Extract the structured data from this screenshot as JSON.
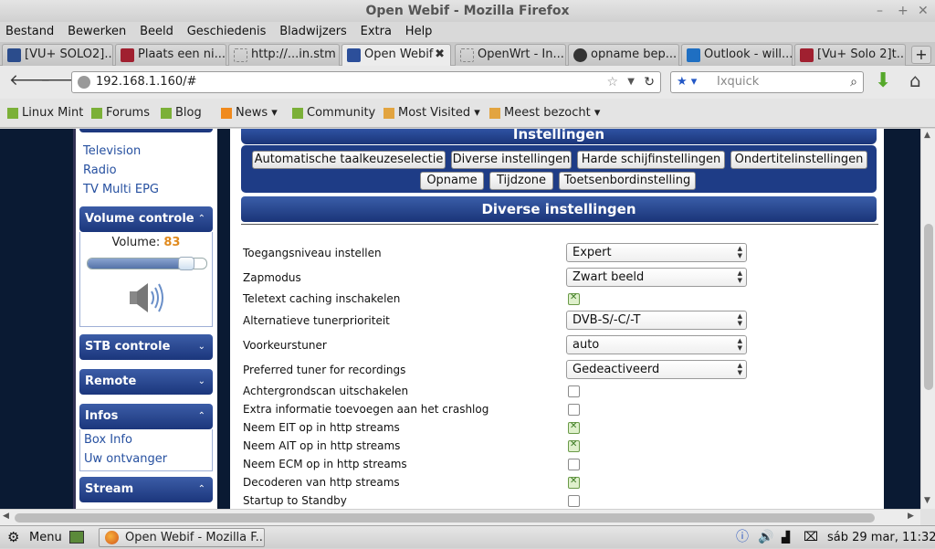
{
  "window": {
    "title": "Open Webif - Mozilla Firefox"
  },
  "menubar": [
    "Bestand",
    "Bewerken",
    "Beeld",
    "Geschiedenis",
    "Bladwijzers",
    "Extra",
    "Help"
  ],
  "tabs": [
    {
      "label": "[VU+ SOLO2]...",
      "icon": "forum-icon",
      "color": "#2b4c8c"
    },
    {
      "label": "Plaats een ni...",
      "icon": "tv-icon",
      "color": "#a02030"
    },
    {
      "label": "http://...in.stm",
      "icon": "blank-page-icon",
      "color": "#ffffff"
    },
    {
      "label": "Open Webif",
      "icon": "openwebif-icon",
      "color": "#2c4f9a",
      "active": true
    },
    {
      "label": "OpenWrt - In...",
      "icon": "blank-page-icon",
      "color": "#ffffff"
    },
    {
      "label": "opname bep...",
      "icon": "globe-icon",
      "color": "#333333"
    },
    {
      "label": "Outlook - will...",
      "icon": "outlook-icon",
      "color": "#1f6fc2"
    },
    {
      "label": "[Vu+ Solo 2]t...",
      "icon": "tv-icon",
      "color": "#a02030"
    }
  ],
  "navbar": {
    "url": "192.168.1.160/#",
    "search_placeholder": "Ixquick"
  },
  "bookmarks": [
    {
      "label": "Linux Mint",
      "icon": "mint-icon"
    },
    {
      "label": "Forums",
      "icon": "mint-icon"
    },
    {
      "label": "Blog",
      "icon": "mint-icon"
    },
    {
      "label": "News ▾",
      "icon": "rss-icon"
    },
    {
      "label": "Community",
      "icon": "mint-icon"
    },
    {
      "label": "Most Visited ▾",
      "icon": "folder-icon"
    },
    {
      "label": "Meest bezocht ▾",
      "icon": "folder-icon"
    }
  ],
  "sidebar": {
    "top_links": [
      "Television",
      "Radio",
      "TV Multi EPG"
    ],
    "volume": {
      "header": "Volume controle",
      "label": "Volume:",
      "value": "83",
      "level": 83
    },
    "stb": "STB controle",
    "remote": "Remote",
    "infos": {
      "header": "Infos",
      "links": [
        "Box Info",
        "Uw ontvanger"
      ]
    },
    "stream": "Stream",
    "chevron_up": "⌃",
    "chevron_down": "⌄"
  },
  "main": {
    "header": "Instellingen",
    "buttons_row1": [
      "Automatische taalkeuzeselectie",
      "Diverse instellingen",
      "Harde schijfinstellingen",
      "Ondertitelinstellingen"
    ],
    "buttons_row2": [
      "Opname",
      "Tijdzone",
      "Toetsenbordinstelling"
    ],
    "section_title": "Diverse instellingen",
    "settings": [
      {
        "label": "Toegangsniveau instellen",
        "type": "select",
        "value": "Expert"
      },
      {
        "label": "Zapmodus",
        "type": "select",
        "value": "Zwart beeld"
      },
      {
        "label": "Teletext caching inschakelen",
        "type": "checkbox",
        "checked": true
      },
      {
        "label": "Alternatieve tunerprioriteit",
        "type": "select",
        "value": "DVB-S/-C/-T"
      },
      {
        "label": "Voorkeurstuner",
        "type": "select",
        "value": "auto"
      },
      {
        "label": "Preferred tuner for recordings",
        "type": "select",
        "value": "Gedeactiveerd"
      },
      {
        "label": "Achtergrondscan uitschakelen",
        "type": "checkbox",
        "checked": false
      },
      {
        "label": "Extra informatie toevoegen aan het crashlog",
        "type": "checkbox",
        "checked": false
      },
      {
        "label": "Neem EIT op in http streams",
        "type": "checkbox",
        "checked": true
      },
      {
        "label": "Neem AIT op in http streams",
        "type": "checkbox",
        "checked": true
      },
      {
        "label": "Neem ECM op in http streams",
        "type": "checkbox",
        "checked": false
      },
      {
        "label": "Decoderen van http streams",
        "type": "checkbox",
        "checked": true
      },
      {
        "label": "Startup to Standby",
        "type": "checkbox",
        "checked": false
      }
    ]
  },
  "taskbar": {
    "menu": "Menu",
    "window": "Open Webif - Mozilla F...",
    "clock": "sáb 29 mar, 11:32"
  },
  "colors": {
    "accent": "#1e3c86",
    "page_bg": "#0a1a33",
    "volume_value": "#e08a1e"
  }
}
